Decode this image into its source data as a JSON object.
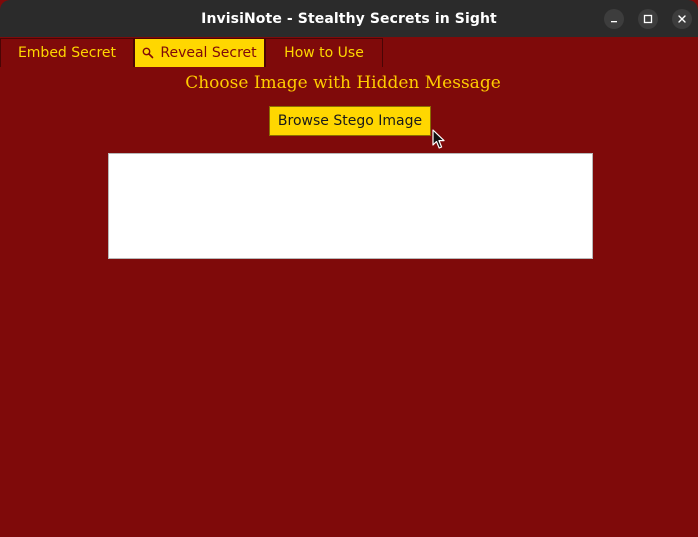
{
  "window": {
    "title": "InvisiNote - Stealthy Secrets in Sight",
    "controls": [
      "minimize-icon",
      "maximize-icon",
      "close-icon"
    ]
  },
  "tabs": [
    {
      "label": "Embed Secret",
      "active": false
    },
    {
      "label": "Reveal Secret",
      "active": true,
      "icon": "magnifier-icon"
    },
    {
      "label": "How to Use",
      "active": false
    }
  ],
  "reveal": {
    "heading": "Choose Image with Hidden Message",
    "browse_label": "Browse Stego Image",
    "message_text": ""
  },
  "colors": {
    "background": "#7f0a0a",
    "accent": "#ffd700",
    "titlebar": "#2b2b2b",
    "output_bg": "#ffffff"
  }
}
